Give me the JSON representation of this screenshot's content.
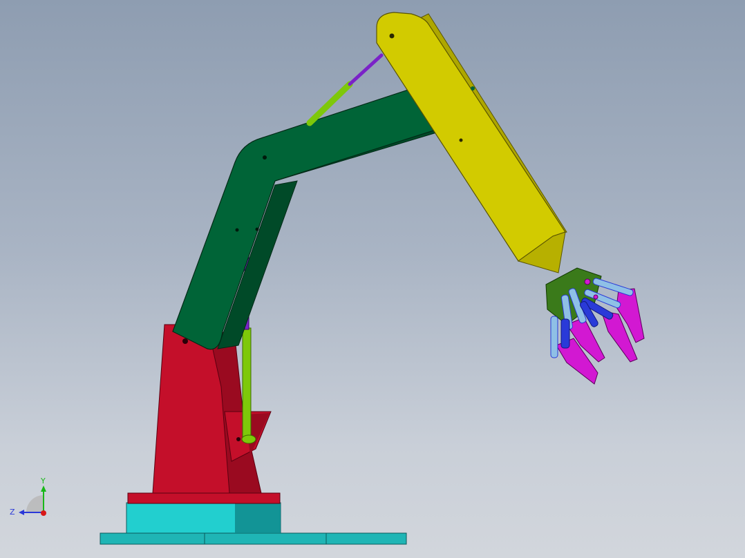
{
  "viewport": {
    "background_top": "#8e9db1",
    "background_bottom": "#d2d6dc"
  },
  "colors": {
    "base_plate": "#1fb5b5",
    "base_plate_dark": "#0f8a8c",
    "pedestal_cap": "#c40f2a",
    "pedestal": "#c40f2a",
    "pedestal_shadow": "#9a0a20",
    "lower_arm": "#006437",
    "lower_arm_dark": "#004a28",
    "upper_arm": "#d2cb00",
    "upper_arm_dark": "#aea700",
    "actuator_rod": "#7a22c8",
    "actuator_cylinder": "#7ec80a",
    "gripper_finger": "#d218d2",
    "gripper_link": "#8fc0e6",
    "gripper_link_dark": "#2a3ad8",
    "gripper_palm": "#3a7a1a"
  },
  "triad": {
    "y_label": "Y",
    "z_label": "Z",
    "y_color": "#18b818",
    "z_color": "#2a38d8",
    "x_color": "#d81818"
  }
}
